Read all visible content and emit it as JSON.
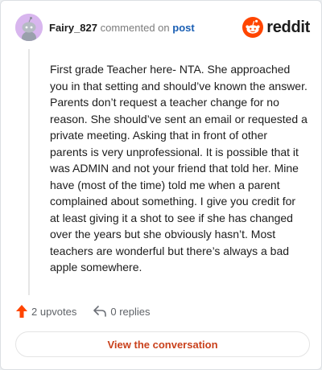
{
  "header": {
    "author": "Fairy_827",
    "action_text": "commented on",
    "post_link": "post",
    "logo_text": "reddit"
  },
  "comment": {
    "body": "First grade Teacher here- NTA. She approached you in that setting and should’ve known the answer. Parents don’t request a teacher change for no reason. She should’ve sent an email or requested a private meeting. Asking that in front of other parents is very unprofessional. It is possible that it was ADMIN and not your friend that told her. Mine have (most of the time) told me when a parent complained about something. I give you credit for at least giving it a shot to see if she has changed over the years but she obviously hasn’t. Most teachers are wonderful but there’s always a bad apple somewhere."
  },
  "actions": {
    "upvotes_label": "2 upvotes",
    "replies_label": "0 replies"
  },
  "footer": {
    "view_button_label": "View the conversation"
  },
  "colors": {
    "brand": "#ff4500",
    "link": "#1a5fb4",
    "button_text": "#c9411c",
    "avatar_bg": "#d8b6ee"
  },
  "icons": {
    "avatar": "snoo-avatar-icon",
    "logo": "reddit-logo-icon",
    "upvote": "upvote-arrow-icon",
    "reply": "reply-arrow-icon"
  }
}
